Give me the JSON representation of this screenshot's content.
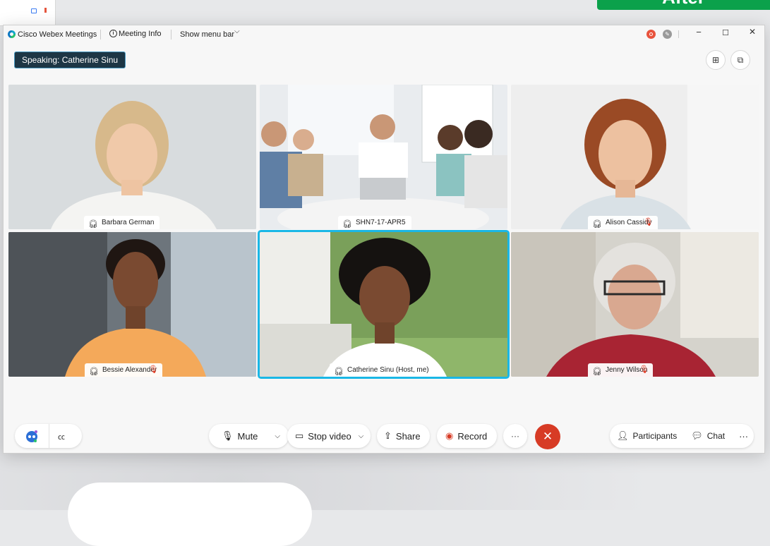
{
  "banner": {
    "label": "After"
  },
  "window": {
    "app_title": "Cisco Webex Meetings",
    "meeting_info": "Meeting Info",
    "show_menu_bar": "Show menu bar",
    "controls": {
      "minimize": "−",
      "maximize": "☐",
      "close": "✕"
    }
  },
  "speaking_label": "Speaking: Catherine Sinu",
  "participants": [
    {
      "name": "Barbara German",
      "muted": false
    },
    {
      "name": "SHN7-17-APR5",
      "muted": false
    },
    {
      "name": "Alison Cassidy",
      "muted": true
    },
    {
      "name": "Bessie Alexander",
      "muted": true
    },
    {
      "name": "Catherine Sinu (Host, me)",
      "muted": false,
      "active": true
    },
    {
      "name": "Jenny Wilson",
      "muted": true
    }
  ],
  "toolbar": {
    "mute": "Mute",
    "stop_video": "Stop video",
    "share": "Share",
    "record": "Record",
    "more": "···",
    "end": "✕",
    "participants": "Participants",
    "chat": "Chat",
    "more_right": "···"
  },
  "colors": {
    "active_border": "#1ab7e6",
    "end_call": "#d73b25",
    "banner": "#0ba14b",
    "record_indicator": "#e8533d"
  }
}
